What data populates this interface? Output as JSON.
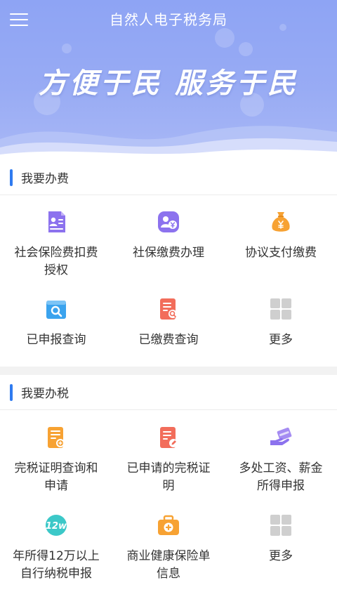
{
  "header": {
    "title": "自然人电子税务局"
  },
  "banner": {
    "slogan": "方便于民  服务于民"
  },
  "section_fees": {
    "title": "我要办费",
    "items": [
      {
        "label": "社会保险费扣费授权",
        "icon": "id-card-icon"
      },
      {
        "label": "社保缴费办理",
        "icon": "yuan-person-icon"
      },
      {
        "label": "协议支付缴费",
        "icon": "money-bag-icon"
      },
      {
        "label": "已申报查询",
        "icon": "search-folder-icon"
      },
      {
        "label": "已缴费查询",
        "icon": "document-search-icon"
      },
      {
        "label": "更多",
        "icon": "grid-icon"
      }
    ]
  },
  "section_tax": {
    "title": "我要办税",
    "items": [
      {
        "label": "完税证明查询和申请",
        "icon": "certificate-icon"
      },
      {
        "label": "已申请的完税证明",
        "icon": "document-edit-icon"
      },
      {
        "label": "多处工资、薪金所得申报",
        "icon": "salary-hand-icon"
      },
      {
        "label": "年所得12万以上自行纳税申报",
        "icon": "12w-badge-icon"
      },
      {
        "label": "商业健康保险单信息",
        "icon": "medical-kit-icon"
      },
      {
        "label": "更多",
        "icon": "grid-icon"
      }
    ]
  },
  "colors": {
    "accent": "#2f7bf0",
    "banner": "#98abf4",
    "purple": "#8c72ee",
    "orange": "#f7a233",
    "coral": "#f26d5b",
    "teal": "#3cc8c8",
    "gray": "#cfcfcf"
  }
}
